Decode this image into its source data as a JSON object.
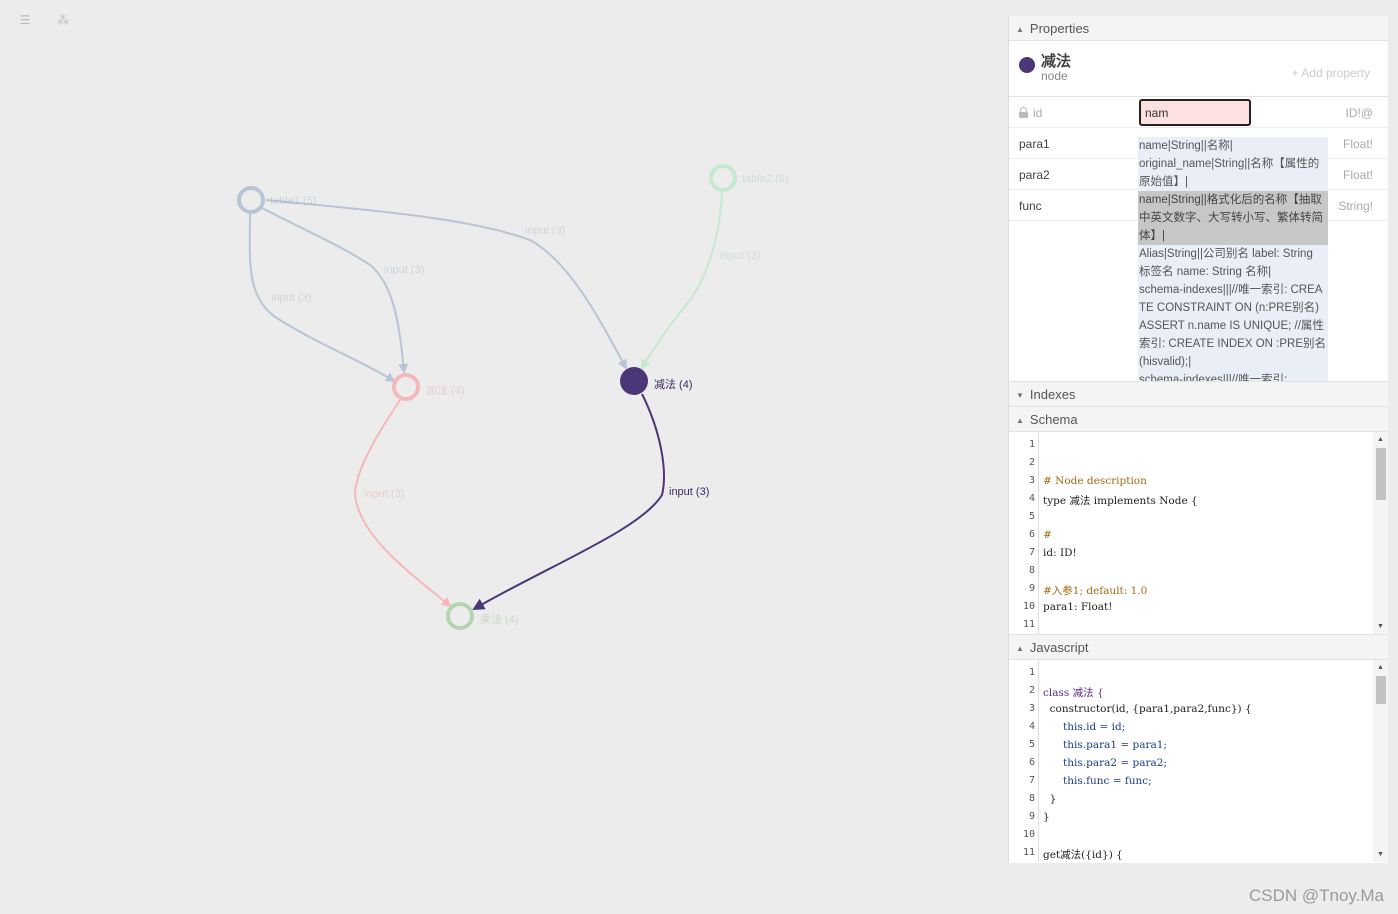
{
  "toolbar": {
    "menu_icon": "☰",
    "graph_icon": "⁂"
  },
  "graph": {
    "nodes": [
      {
        "id": "table1",
        "label": "table1 (5)"
      },
      {
        "id": "table2",
        "label": "table2 (5)"
      },
      {
        "id": "add",
        "label": "加法 (4)"
      },
      {
        "id": "sub",
        "label": "减法 (4)"
      },
      {
        "id": "mul",
        "label": "乘法 (4)"
      }
    ],
    "edges": [
      {
        "from": "table1",
        "to": "add",
        "label": "input (3)"
      },
      {
        "from": "table1",
        "to": "add",
        "label": "input (3)"
      },
      {
        "from": "table1",
        "to": "sub",
        "label": "input (3)"
      },
      {
        "from": "table2",
        "to": "sub",
        "label": "input (3)"
      },
      {
        "from": "add",
        "to": "mul",
        "label": "input (3)"
      },
      {
        "from": "sub",
        "to": "mul",
        "label": "input (3)"
      }
    ],
    "colors": {
      "table": "#b8c5d6",
      "table2": "#c5e8d0",
      "add": "#f5b8b8",
      "sub": "#4b3678",
      "mul": "#b5d4b0"
    }
  },
  "panel": {
    "properties": {
      "section_title": "Properties",
      "node_name": "减法",
      "node_kind": "node",
      "add_property": "+ Add property",
      "rows": [
        {
          "name": "id",
          "type": "ID!@",
          "value": "nam"
        },
        {
          "name": "para1",
          "type": "Float!"
        },
        {
          "name": "para2",
          "type": "Float!"
        },
        {
          "name": "func",
          "type": "String!"
        }
      ]
    },
    "autocomplete": [
      "name|String||名称|",
      "original_name|String||名称【属性的原始值】|",
      "name|String||格式化后的名称【抽取中英文数字、大写转小写、繁体转简体】|",
      "Alias|String||公司别名 label: String 标签名 name: String 名称|",
      "schema-indexes|||//唯一索引: CREATE CONSTRAINT ON (n:PRE别名) ASSERT n.name IS UNIQUE; //属性索引: CREATE INDEX ON :PRE别名(hisvalid);|",
      "schema-indexes|||//唯一索引:"
    ],
    "indexes_title": "Indexes",
    "schema": {
      "title": "Schema",
      "lines": [
        "",
        "",
        "# Node description",
        "type 减法 implements Node {",
        "",
        "#",
        "id: ID!",
        "",
        "#入参1; default: 1.0",
        "para1: Float!",
        ""
      ]
    },
    "javascript": {
      "title": "Javascript",
      "lines": [
        "",
        "class 减法 {",
        "  constructor(id, {para1,para2,func}) {",
        "      this.id = id;",
        "      this.para1 = para1;",
        "      this.para2 = para2;",
        "      this.func = func;",
        "  }",
        "}",
        "",
        "get减法({id}) {"
      ]
    }
  },
  "watermark": "CSDN @Tnoy.Ma"
}
